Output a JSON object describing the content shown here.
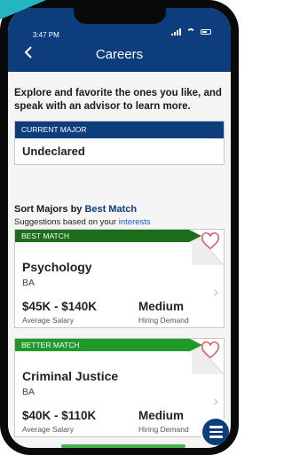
{
  "status": {
    "time": "3:47 PM"
  },
  "header": {
    "title": "Careers",
    "back_icon": "chevron-left-icon"
  },
  "intro": {
    "text": "Explore and favorite the ones you like, and speak with an advisor to learn more."
  },
  "current_major": {
    "label": "CURRENT MAJOR",
    "value": "Undeclared"
  },
  "sort": {
    "prefix": "Sort Majors by ",
    "mode": "Best Match",
    "sub_prefix": "Suggestions based on your ",
    "sub_link": "interests"
  },
  "majors": [
    {
      "badge": "BEST MATCH",
      "name": "Psychology",
      "degree": "BA",
      "salary": "$45K - $140K",
      "salary_label": "Average Salary",
      "demand": "Medium",
      "demand_label": "Hiring Demand"
    },
    {
      "badge": "BETTER MATCH",
      "name": "Criminal Justice",
      "degree": "BA",
      "salary": "$40K - $110K",
      "salary_label": "Average Salary",
      "demand": "Medium",
      "demand_label": "Hiring Demand"
    }
  ],
  "colors": {
    "primary": "#0e3d7d",
    "best_match": "#1d6e1b",
    "better_match": "#1f9a2a",
    "heart": "#e0555a",
    "accent": "#23b6c2"
  }
}
